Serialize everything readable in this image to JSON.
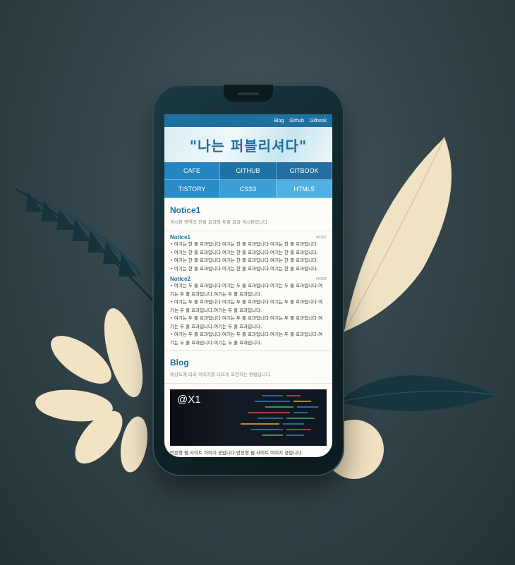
{
  "topbar": {
    "links": [
      "Blog",
      "Github",
      "Gitbook"
    ]
  },
  "hero": {
    "title": "\"나는 퍼블리셔다\""
  },
  "menu": {
    "items": [
      "CAFE",
      "GITHUB",
      "GITBOOK",
      "TISTORY",
      "CSS3",
      "HTML5"
    ]
  },
  "notice": {
    "title": "Notice1",
    "desc": "게시판 영역의 한줄 효과와 두줄 효과 게시판입니다.",
    "list1": {
      "title": "Notice1",
      "more": "MORE",
      "lines": [
        "여기는 한 줄 효과입니다.여기는 한 줄 효과입니다.여기는 한 줄 효과입니다.",
        "여기는 한 줄 효과입니다.여기는 한 줄 효과입니다.여기는 한 줄 효과입니다.",
        "여기는 한 줄 효과입니다.여기는 한 줄 효과입니다.여기는 한 줄 효과입니다.",
        "여기는 한 줄 효과입니다.여기는 한 줄 효과입니다.여기는 한 줄 효과입니다."
      ]
    },
    "list2": {
      "title": "Notice2",
      "more": "MORE",
      "lines": [
        "여기는 두 줄 효과입니다.여기는 두 줄 효과입니다.여기는 두 줄 효과입니다.여기는 두 줄 효과입니다.여기는 두 줄 효과입니다.",
        "여기는 두 줄 효과입니다.여기는 두 줄 효과입니다.여기는 두 줄 효과입니다.여기는 두 줄 효과입니다.여기는 두 줄 효과입니다.",
        "여기는 두 줄 효과입니다.여기는 두 줄 효과입니다.여기는 두 줄 효과입니다.여기는 두 줄 효과입니다.여기는 두 줄 효과입니다.",
        "여기는 두 줄 효과입니다.여기는 두 줄 효과입니다.여기는 두 줄 효과입니다.여기는 두 줄 효과입니다.여기는 두 줄 효과입니다."
      ]
    }
  },
  "blog": {
    "title": "Blog",
    "desc": "해상도에 따라 이미지를 다르게 표현하는 방법입니다.",
    "image_label": "@X1",
    "caption": "반응형 웹 사이트 이미지 공입니다.반응형 웹 사이트 이미지 공입니다."
  },
  "colors": {
    "accent": "#1d6fa0",
    "leaf": "#f2e3c5",
    "dark_leaf": "#1a3b45"
  }
}
